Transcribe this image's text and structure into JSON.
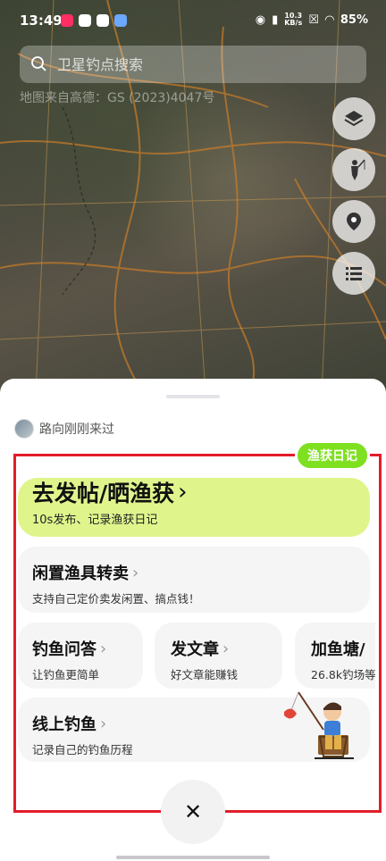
{
  "status_bar": {
    "time": "13:49",
    "net_speed_value": "10.3",
    "net_speed_unit": "KB/s",
    "battery": "85%"
  },
  "search": {
    "placeholder": "卫星钓点搜索"
  },
  "map": {
    "source_text": "地图来自高德：GS (2023)4047号"
  },
  "user_row": {
    "text": "路向刚刚来过"
  },
  "diary_tag": {
    "label": "渔获日记"
  },
  "cards": {
    "post": {
      "title": "去发帖/晒渔获",
      "subtitle": "10s发布、记录渔获日记"
    },
    "sell": {
      "title": "闲置渔具转卖",
      "subtitle": "支持自己定价卖发闲置、搞点钱！"
    },
    "ask": {
      "title": "钓鱼问答",
      "subtitle": "让钓鱼更简单"
    },
    "article": {
      "title": "发文章",
      "subtitle": "好文章能赚钱"
    },
    "pond": {
      "title": "加鱼塘/",
      "subtitle": "26.8k钓场等"
    },
    "online": {
      "title": "线上钓鱼",
      "subtitle": "记录自己的钓鱼历程"
    }
  },
  "close": {
    "label": "✕"
  },
  "colors": {
    "accent_green": "#7ee01f",
    "post_card_bg": "#dff58c",
    "highlight_frame": "#e21d2a"
  }
}
